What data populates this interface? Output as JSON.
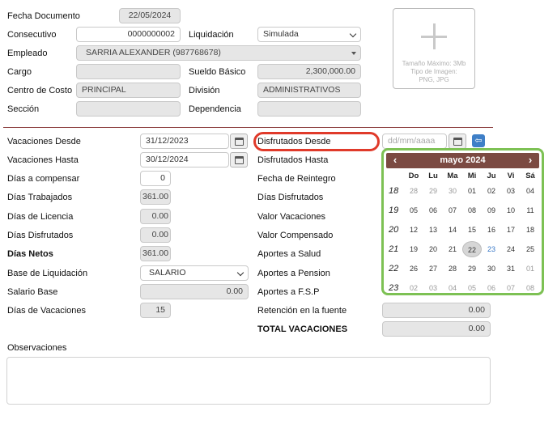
{
  "header": {
    "fecha_documento": {
      "label": "Fecha Documento",
      "value": "22/05/2024"
    },
    "consecutivo": {
      "label": "Consecutivo",
      "value": "0000000002"
    },
    "liquidacion": {
      "label": "Liquidación",
      "value": "Simulada"
    },
    "empleado": {
      "label": "Empleado",
      "value": "SARRIA ALEXANDER (987768678)"
    },
    "cargo": {
      "label": "Cargo",
      "value": ""
    },
    "sueldo_basico": {
      "label": "Sueldo Básico",
      "value": "2,300,000.00"
    },
    "centro_costo": {
      "label": "Centro de Costo",
      "value": "PRINCIPAL"
    },
    "division": {
      "label": "División",
      "value": "ADMINISTRATIVOS"
    },
    "seccion": {
      "label": "Sección",
      "value": ""
    },
    "dependencia": {
      "label": "Dependencia",
      "value": ""
    },
    "photo": {
      "max_size": "Tamaño Máximo: 3Mb",
      "image_type": "Tipo de Imagen:",
      "formats": "PNG, JPG"
    }
  },
  "left": {
    "vacaciones_desde": {
      "label": "Vacaciones Desde",
      "value": "31/12/2023"
    },
    "vacaciones_hasta": {
      "label": "Vacaciones Hasta",
      "value": "30/12/2024"
    },
    "dias_compensar": {
      "label": "Días a compensar",
      "value": "0"
    },
    "dias_trabajados": {
      "label": "Días Trabajados",
      "value": "361.00"
    },
    "dias_licencia": {
      "label": "Días de Licencia",
      "value": "0.00"
    },
    "dias_disfrutados": {
      "label": "Días Disfrutados",
      "value": "0.00"
    },
    "dias_netos": {
      "label": "Días Netos",
      "value": "361.00"
    },
    "base_liquidacion": {
      "label": "Base de Liquidación",
      "value": "SALARIO"
    },
    "salario_base": {
      "label": "Salario Base",
      "value": "0.00"
    },
    "dias_vacaciones": {
      "label": "Días de Vacaciones",
      "value": "15"
    }
  },
  "right": {
    "disfrutados_desde": {
      "label": "Disfrutados Desde",
      "placeholder": "dd/mm/aaaa"
    },
    "disfrutados_hasta": {
      "label": "Disfrutados Hasta"
    },
    "fecha_reintegro": {
      "label": "Fecha de Reintegro"
    },
    "dias_disfrutados": {
      "label": "Días Disfrutados"
    },
    "valor_vacaciones": {
      "label": "Valor Vacaciones"
    },
    "valor_compensado": {
      "label": "Valor Compensado"
    },
    "aportes_salud": {
      "label": "Aportes a Salud"
    },
    "aportes_pension": {
      "label": "Aportes a Pension"
    },
    "aportes_fsp": {
      "label": "Aportes a F.S.P"
    },
    "retencion": {
      "label": "Retención en la fuente",
      "value": "0.00"
    },
    "total": {
      "label": "TOTAL VACACIONES",
      "value": "0.00"
    }
  },
  "observaciones": {
    "label": "Observaciones"
  },
  "calendar": {
    "title": "mayo 2024",
    "prev": "‹",
    "next": "›",
    "weekdays": [
      "Do",
      "Lu",
      "Ma",
      "Mi",
      "Ju",
      "Vi",
      "Sá"
    ],
    "weeks": [
      {
        "num": "18",
        "days": [
          "28",
          "29",
          "30",
          "01",
          "02",
          "03",
          "04"
        ]
      },
      {
        "num": "19",
        "days": [
          "05",
          "06",
          "07",
          "08",
          "09",
          "10",
          "11"
        ]
      },
      {
        "num": "20",
        "days": [
          "12",
          "13",
          "14",
          "15",
          "16",
          "17",
          "18"
        ]
      },
      {
        "num": "21",
        "days": [
          "19",
          "20",
          "21",
          "22",
          "23",
          "24",
          "25"
        ]
      },
      {
        "num": "22",
        "days": [
          "26",
          "27",
          "28",
          "29",
          "30",
          "31",
          "01"
        ]
      },
      {
        "num": "23",
        "days": [
          "02",
          "03",
          "04",
          "05",
          "06",
          "07",
          "08"
        ]
      }
    ],
    "today": "22",
    "colors": {
      "header": "#7b4a42",
      "border": "#7dc154",
      "highlight": "#e03a2a",
      "accent": "#3a79c7"
    }
  }
}
